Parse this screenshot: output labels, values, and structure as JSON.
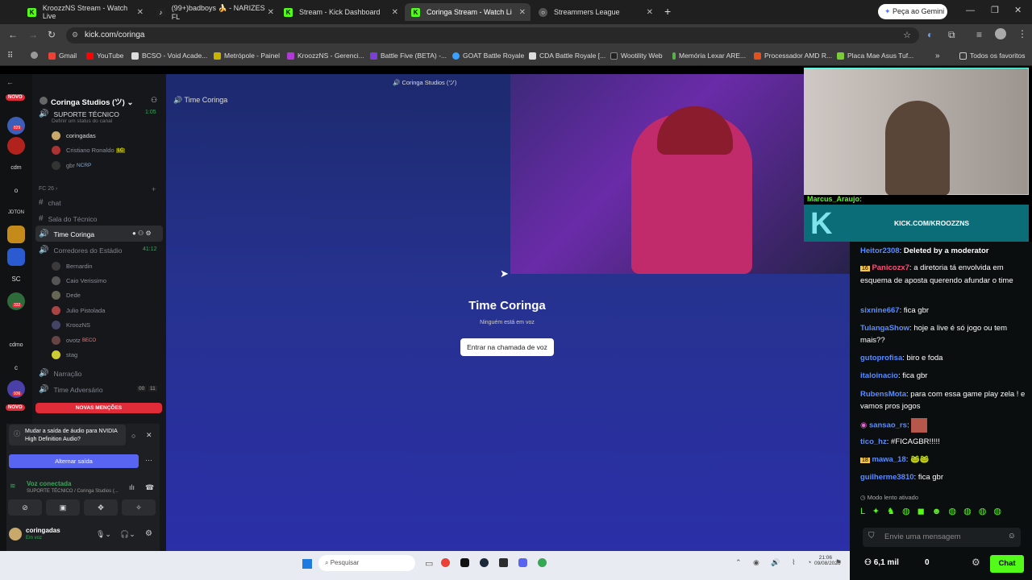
{
  "browser": {
    "tabs": [
      {
        "label": "KroozzNS Stream - Watch Live",
        "fav": "K"
      },
      {
        "label": "(99+)badboys 🍌 - NARIZES FL",
        "fav": "♪"
      },
      {
        "label": "Stream - Kick Dashboard",
        "fav": "K"
      },
      {
        "label": "Coringa Stream - Watch Li",
        "fav": "K"
      },
      {
        "label": "Streammers League",
        "fav": "○"
      }
    ],
    "gemini": "Peça ao Gemini",
    "url": "kick.com/coringa",
    "bookmarks": [
      "Gmail",
      "YouTube",
      "BCSO - Void Acade...",
      "Metrópole - Painel",
      "KroozzNS - Gerenci...",
      "Battle Five (BETA) -...",
      "GOAT Battle Royale",
      "CDA Battle Royale [...",
      "Wootility Web",
      "Memória Lexar ARE...",
      "Processador AMD R...",
      "Placa Mae Asus Tuf..."
    ],
    "all_bookmarks": "Todos os favoritos"
  },
  "discord": {
    "top_title": "Coringa Studios (ツ)",
    "server_name": "Coringa Studios (ツ)",
    "server_badges": [
      "NOVO",
      "829",
      "474",
      "cdm",
      "o",
      "JDTON",
      "SC",
      "332",
      "cdmo",
      "c",
      "936",
      "NOVO"
    ],
    "channel_header": "Time Coringa",
    "suporte": "SUPORTE TÉCNICO",
    "suporte_count": "1:05",
    "suporte_status": "Definir um status do canal",
    "suporte_members": [
      {
        "name": "coringadas",
        "tag": ""
      },
      {
        "name": "Cristiano Ronaldo",
        "tag": "LC"
      },
      {
        "name": "gbr",
        "tag": "NCRP"
      }
    ],
    "category": "FC 26",
    "channels": [
      "chat",
      "Sala do Técnico",
      "Time Coringa",
      "Corredores do Estádio"
    ],
    "corredores_count": "41:12",
    "corredores_members": [
      {
        "name": "Bernardin",
        "tag": ""
      },
      {
        "name": "Caio Verissimo",
        "tag": ""
      },
      {
        "name": "Dede",
        "tag": ""
      },
      {
        "name": "Julio Pistolada",
        "tag": ""
      },
      {
        "name": "KroozNS",
        "tag": ""
      },
      {
        "name": "ovotz",
        "tag": "BECO"
      },
      {
        "name": "stag",
        "tag": ""
      }
    ],
    "narracao": "Narração",
    "adversario": "Time Adversário",
    "adversario_counts": [
      "00",
      "11"
    ],
    "novas_mencoes": "NOVAS MENÇÕES",
    "audio_notice": "Mudar a saída de áudio para NVIDIA High Definition Audio?",
    "alternar": "Alternar saída",
    "voice_connected": "Voz conectada",
    "voice_channel": "SUPORTE TÉCNICO / Coringa Studios (...",
    "user_name": "coringadas",
    "user_status": "Em voz",
    "stage_title": "Time Coringa",
    "stage_sub": "Ninguém está em voz",
    "join_button": "Entrar na chamada de voz"
  },
  "kick": {
    "banner": "KICK.COM/KROOZZNS",
    "top_user": "Marcus_Araujo:",
    "messages": [
      {
        "user": "Heitor2308",
        "text": "Deleted by a moderator",
        "color": "#5a8cff",
        "badge": ""
      },
      {
        "user": "Panicozx7",
        "text": "a diretoria tá envolvida em esquema de aposta querendo afundar o time",
        "color": "#ff4f7a",
        "badge": "16"
      },
      {
        "user": "sixnine667",
        "text": "fica gbr",
        "color": "#5a8cff",
        "badge": ""
      },
      {
        "user": "TulangaShow",
        "text": "hoje a live é só jogo ou tem mais??",
        "color": "#5a8cff",
        "badge": ""
      },
      {
        "user": "gutoprofisa",
        "text": "biro e foda",
        "color": "#5a8cff",
        "badge": ""
      },
      {
        "user": "italoinacio",
        "text": "fica gbr",
        "color": "#5a8cff",
        "badge": ""
      },
      {
        "user": "RubensMota",
        "text": "para com essa game play zela ! e vamos pros jogos",
        "color": "#5a8cff",
        "badge": ""
      },
      {
        "user": "sansao_rs",
        "text": "",
        "color": "#5a8cff",
        "badge": ""
      },
      {
        "user": "tico_hz",
        "text": "#FICAGBR!!!!!",
        "color": "#5a8cff",
        "badge": ""
      },
      {
        "user": "mawa_18",
        "text": "",
        "color": "#5a8cff",
        "badge": "18"
      },
      {
        "user": "guilherme3810",
        "text": "fica gbr",
        "color": "#5a8cff",
        "badge": ""
      }
    ],
    "slow_mode": "Modo lento ativado",
    "placeholder": "Envie uma mensagem",
    "viewers": "6,1 mil",
    "likes": "0",
    "chat_button": "Chat"
  },
  "taskbar": {
    "search": "Pesquisar",
    "time": "21:06",
    "date": "09/08/2026"
  }
}
